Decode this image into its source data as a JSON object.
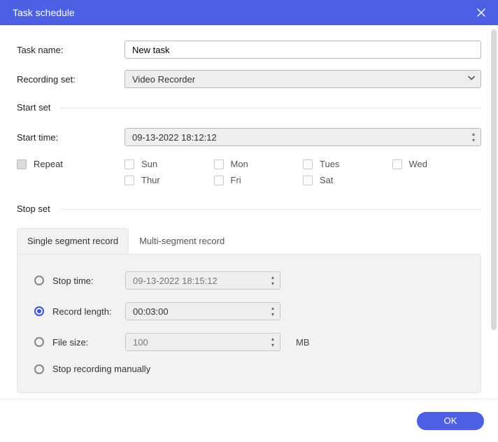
{
  "title": "Task schedule",
  "taskName": {
    "label": "Task name:",
    "value": "New task"
  },
  "recordingSet": {
    "label": "Recording set:",
    "value": "Video Recorder"
  },
  "startSet": {
    "title": "Start set",
    "startTime": {
      "label": "Start time:",
      "value": "09-13-2022 18:12:12"
    },
    "repeat": {
      "label": "Repeat",
      "days": [
        "Sun",
        "Mon",
        "Tues",
        "Wed",
        "Thur",
        "Fri",
        "Sat"
      ]
    }
  },
  "stopSet": {
    "title": "Stop set",
    "tabs": [
      "Single segment record",
      "Multi-segment record"
    ],
    "activeTab": 0,
    "options": {
      "stopTime": {
        "label": "Stop time:",
        "value": "09-13-2022 18:15:12"
      },
      "recordLength": {
        "label": "Record length:",
        "value": "00:03:00"
      },
      "fileSize": {
        "label": "File size:",
        "value": "100",
        "unit": "MB"
      },
      "manual": {
        "label": "Stop recording manually"
      }
    },
    "selected": "recordLength"
  },
  "okLabel": "OK"
}
